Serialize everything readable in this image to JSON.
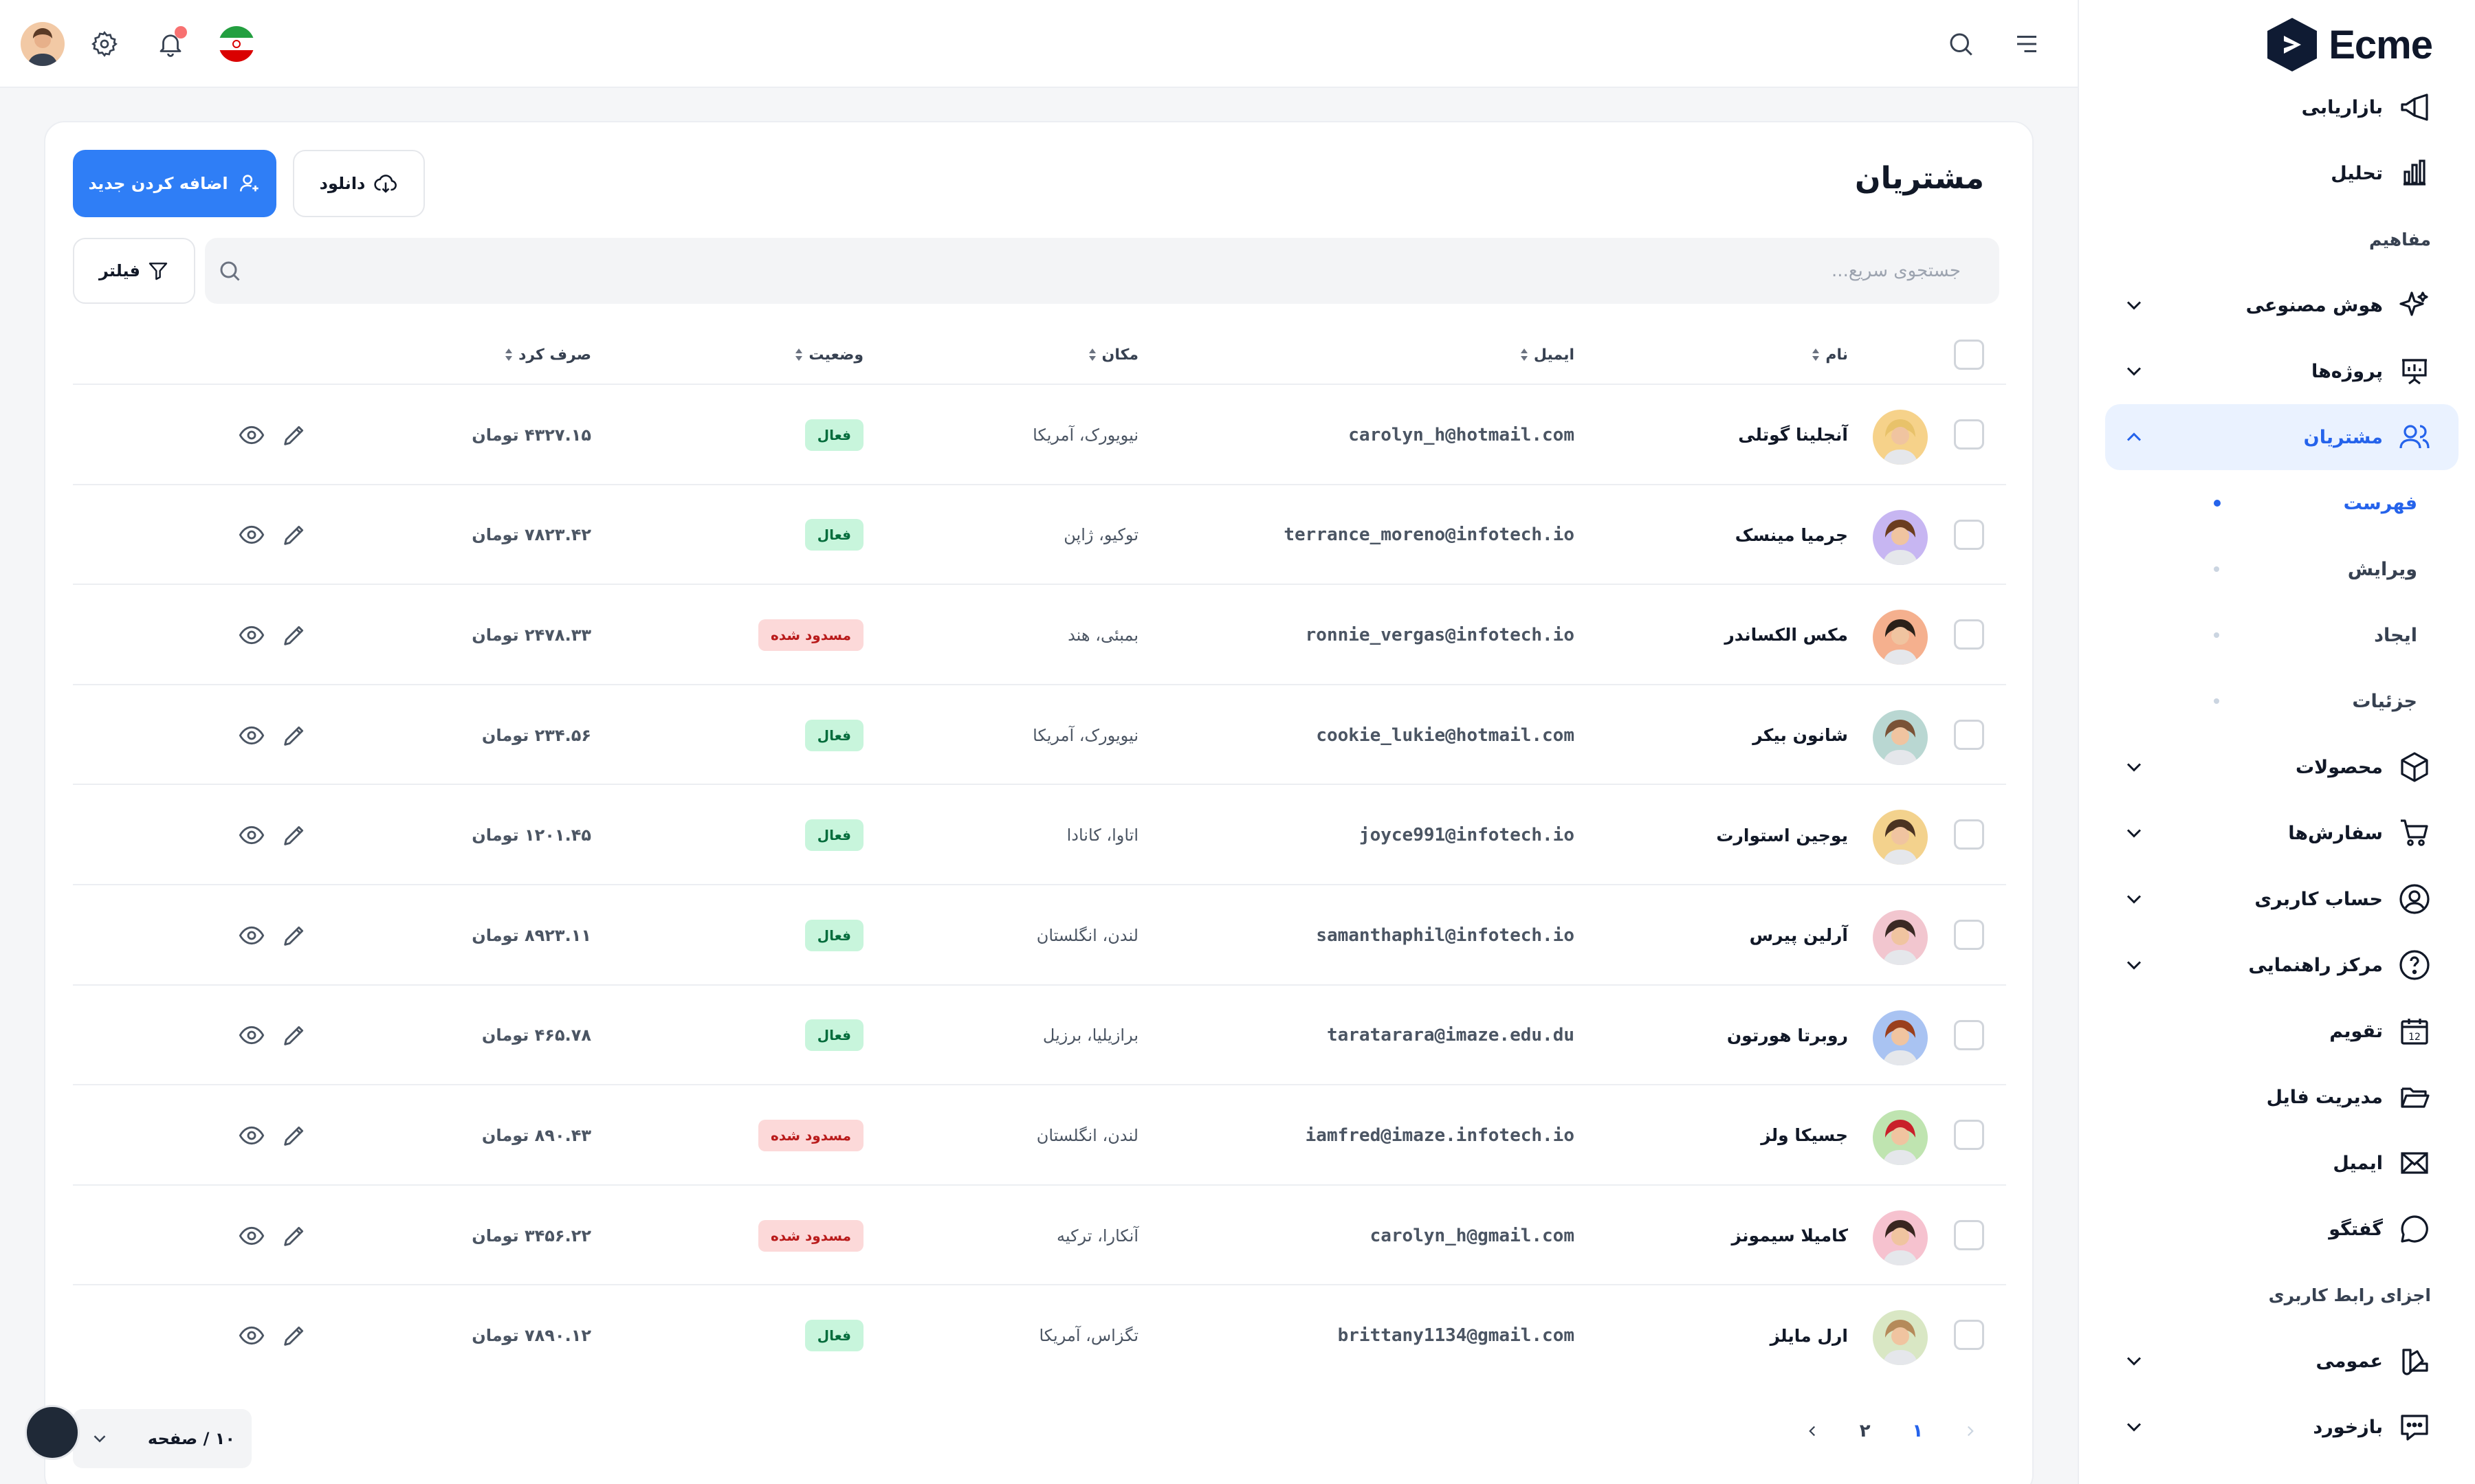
{
  "brand": {
    "name": "Ecme"
  },
  "colors": {
    "primary": "#2f7ef6",
    "active_badge": "#c8f5dc",
    "blocked_badge": "#fcd9d9",
    "sidebar_active": "#eaf2ff"
  },
  "header": {
    "language_flag": "iran-flag-icon"
  },
  "sidebar": {
    "items": [
      {
        "label": "بازاریابی",
        "icon": "megaphone-icon"
      },
      {
        "label": "تحلیل",
        "icon": "bar-chart-icon"
      }
    ],
    "concepts_heading": "مفاهیم",
    "concepts": [
      {
        "label": "هوش مصنوعی",
        "icon": "sparkle-icon"
      },
      {
        "label": "پروژه‌ها",
        "icon": "presentation-icon"
      },
      {
        "label": "مشتریان",
        "icon": "users-icon"
      }
    ],
    "customers_sub": [
      {
        "label": "فهرست"
      },
      {
        "label": "ویرایش"
      },
      {
        "label": "ایجاد"
      },
      {
        "label": "جزئیات"
      }
    ],
    "more": [
      {
        "label": "محصولات",
        "icon": "box-icon"
      },
      {
        "label": "سفارش‌ها",
        "icon": "cart-icon"
      },
      {
        "label": "حساب کاربری",
        "icon": "user-circle-icon"
      },
      {
        "label": "مرکز راهنمایی",
        "icon": "help-icon"
      },
      {
        "label": "تقویم",
        "icon": "calendar-icon"
      },
      {
        "label": "مدیریت فایل",
        "icon": "folder-icon"
      },
      {
        "label": "ایمیل",
        "icon": "mail-icon"
      },
      {
        "label": "گفتگو",
        "icon": "chat-icon"
      }
    ],
    "ui_heading": "اجزای رابط کاربری",
    "ui_items": [
      {
        "label": "عمومی",
        "icon": "swatch-icon"
      },
      {
        "label": "بازخورد",
        "icon": "feedback-icon"
      }
    ]
  },
  "page": {
    "title": "مشتریان",
    "add_button": "اضافه کردن جدید",
    "download_button": "دانلود",
    "filter_button": "فیلتر",
    "search_placeholder": "جستجوی سریع...",
    "columns": {
      "name": "نام",
      "email": "ایمیل",
      "location": "مکان",
      "status": "وضعیت",
      "spent": "صرف کرد"
    },
    "rows": [
      {
        "name": "آنجلینا گوتلی",
        "email": "carolyn_h@hotmail.com",
        "location": "نیویورک، آمریکا",
        "status": "فعال",
        "status_type": "active",
        "spent": "۴۳۲۷.۱۵ تومان",
        "avatar_bg": "#f6d28a",
        "hair": "#e8c26a"
      },
      {
        "name": "جرمیا مینسک",
        "email": "terrance_moreno@infotech.io",
        "location": "توکیو، ژاپن",
        "status": "فعال",
        "status_type": "active",
        "spent": "۷۸۲۳.۴۲ تومان",
        "avatar_bg": "#c7b6f2",
        "hair": "#6b3d1f"
      },
      {
        "name": "مکس الکساندر",
        "email": "ronnie_vergas@infotech.io",
        "location": "بمبئی، هند",
        "status": "مسدود شده",
        "status_type": "blocked",
        "spent": "۲۴۷۸.۳۳ تومان",
        "avatar_bg": "#f5b08e",
        "hair": "#2b2119"
      },
      {
        "name": "شانون بیکر",
        "email": "cookie_lukie@hotmail.com",
        "location": "نیویورک، آمریکا",
        "status": "فعال",
        "status_type": "active",
        "spent": "۲۳۴.۵۶ تومان",
        "avatar_bg": "#b9d7d2",
        "hair": "#7a5236"
      },
      {
        "name": "یوجین استوارت",
        "email": "joyce991@infotech.io",
        "location": "اتاوا، کانادا",
        "status": "فعال",
        "status_type": "active",
        "spent": "۱۲۰۱.۴۵ تومان",
        "avatar_bg": "#f3d28d",
        "hair": "#4a3322"
      },
      {
        "name": "آرلین پیرس",
        "email": "samanthaphil@infotech.io",
        "location": "لندن، انگلستان",
        "status": "فعال",
        "status_type": "active",
        "spent": "۸۹۲۳.۱۱ تومان",
        "avatar_bg": "#f2c6cf",
        "hair": "#3b2a24"
      },
      {
        "name": "روبرتا هورتون",
        "email": "taratarara@imaze.edu.du",
        "location": "برازیلیا، برزیل",
        "status": "فعال",
        "status_type": "active",
        "spent": "۴۶۵.۷۸ تومان",
        "avatar_bg": "#a9c3f2",
        "hair": "#9a3f1d"
      },
      {
        "name": "جسیکا ولز",
        "email": "iamfred@imaze.infotech.io",
        "location": "لندن، انگلستان",
        "status": "مسدود شده",
        "status_type": "blocked",
        "spent": "۸۹۰.۴۳ تومان",
        "avatar_bg": "#bfe4b0",
        "hair": "#c9202a"
      },
      {
        "name": "کامیلا سیمونز",
        "email": "carolyn_h@gmail.com",
        "location": "آنکارا، ترکیه",
        "status": "مسدود شده",
        "status_type": "blocked",
        "spent": "۳۴۵۶.۲۲ تومان",
        "avatar_bg": "#f6c2cf",
        "hair": "#3a2620"
      },
      {
        "name": "ارل مایلز",
        "email": "brittany1134@gmail.com",
        "location": "تگزاس، آمریکا",
        "status": "فعال",
        "status_type": "active",
        "spent": "۷۸۹۰.۱۲ تومان",
        "avatar_bg": "#d9e7c4",
        "hair": "#b58a5a"
      }
    ],
    "pagination": {
      "pages": [
        "۱",
        "۲"
      ],
      "current": "۱"
    },
    "page_size": "۱۰ / صفحه"
  }
}
